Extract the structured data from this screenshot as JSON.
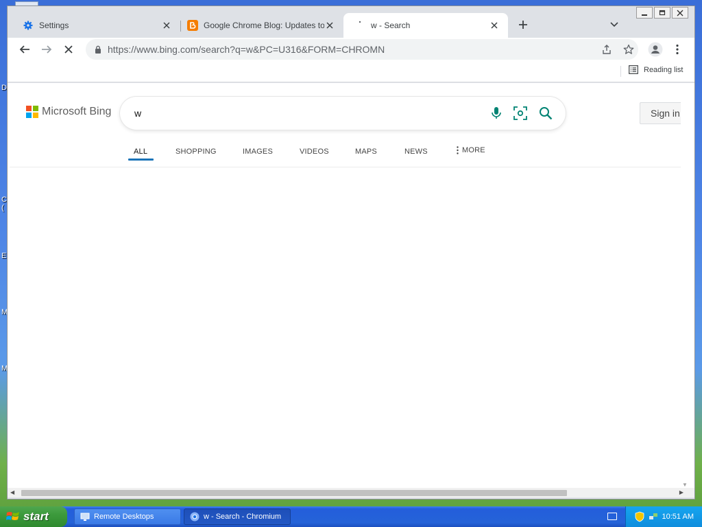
{
  "desktop": {
    "edge_letters": [
      "D",
      "C",
      "(",
      "E",
      "M",
      "M"
    ]
  },
  "window": {
    "controls": {
      "minimize": "minimize",
      "restore": "restore",
      "close": "close"
    }
  },
  "tabs": [
    {
      "title": "Settings",
      "icon": "gear-icon",
      "active": false
    },
    {
      "title": "Google Chrome Blog: Updates to Ch",
      "icon": "blogger-icon",
      "active": false
    },
    {
      "title": "w - Search",
      "icon": "loading-spinner-icon",
      "active": true
    }
  ],
  "toolbar": {
    "url": "https://www.bing.com/search?q=w&PC=U316&FORM=CHROMN"
  },
  "bookmarks_bar": {
    "reading_list_label": "Reading list"
  },
  "bing": {
    "brand": "Microsoft Bing",
    "query": "w",
    "sign_in_label": "Sign in",
    "nav": [
      {
        "label": "ALL",
        "active": true
      },
      {
        "label": "SHOPPING",
        "active": false
      },
      {
        "label": "IMAGES",
        "active": false
      },
      {
        "label": "VIDEOS",
        "active": false
      },
      {
        "label": "MAPS",
        "active": false
      },
      {
        "label": "NEWS",
        "active": false
      },
      {
        "label": "MORE",
        "active": false
      }
    ],
    "colors": {
      "accent": "#1a73b8",
      "icon": "#008373"
    }
  },
  "taskbar": {
    "start_label": "start",
    "items": [
      {
        "label": "Remote Desktops",
        "active": false
      },
      {
        "label": "w - Search - Chromium",
        "active": true
      }
    ],
    "clock": "10:51 AM"
  }
}
